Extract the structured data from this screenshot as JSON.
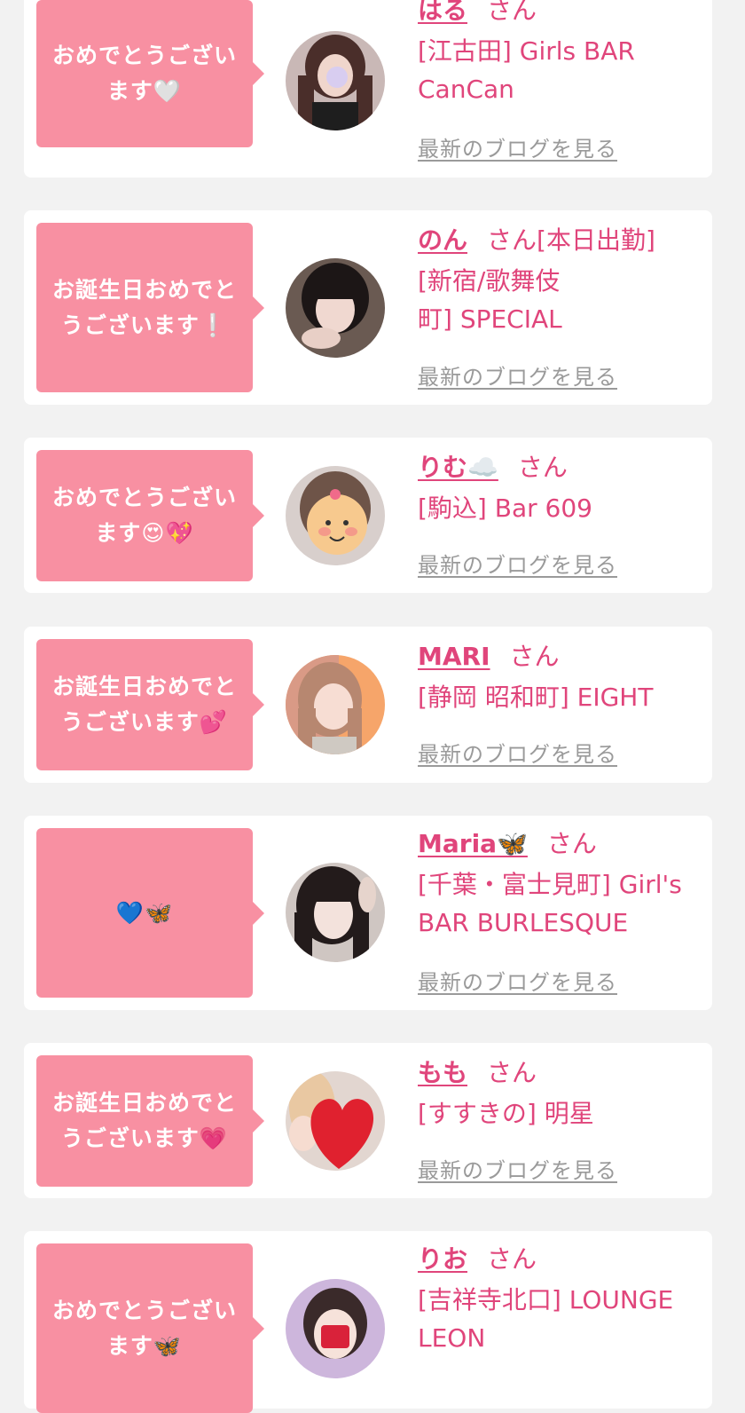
{
  "entries": [
    {
      "message": "おめでとうございます🤍",
      "name": "はる",
      "suffix": "さん",
      "shop": "[江古田] Girls BAR CanCan",
      "blog_link": "最新のブログを見る"
    },
    {
      "message": "お誕生日おめでとうございます❕",
      "name": "のん",
      "suffix": "さん[本日出勤]",
      "shop": "[新宿/歌舞伎町] SPECIAL",
      "blog_link": "最新のブログを見る"
    },
    {
      "message": "おめでとうございます😍💖",
      "name": "りむ☁️",
      "suffix": "さん",
      "shop": "[駒込] Bar 609",
      "blog_link": "最新のブログを見る"
    },
    {
      "message": "お誕生日おめでとうございます💕",
      "name": "MARI",
      "suffix": "さん",
      "shop": "[静岡 昭和町] EIGHT",
      "blog_link": "最新のブログを見る"
    },
    {
      "message": "💙🦋",
      "name": "Maria🦋",
      "suffix": "さん",
      "shop": "[千葉・富士見町] Girl's BAR BURLESQUE",
      "blog_link": "最新のブログを見る"
    },
    {
      "message": "お誕生日おめでとうございます💗",
      "name": "もも",
      "suffix": "さん",
      "shop": "[すすきの] 明星",
      "blog_link": "最新のブログを見る"
    },
    {
      "message": "おめでとうございます🦋",
      "name": "りお",
      "suffix": "さん",
      "shop": "[吉祥寺北口] LOUNGE LEON",
      "blog_link": "最新のブログを見る"
    }
  ],
  "colors": {
    "bubble": "#f890a2",
    "name": "#e0457b",
    "link": "#9a9a9a",
    "background": "#f2f2f2",
    "card": "#ffffff"
  }
}
